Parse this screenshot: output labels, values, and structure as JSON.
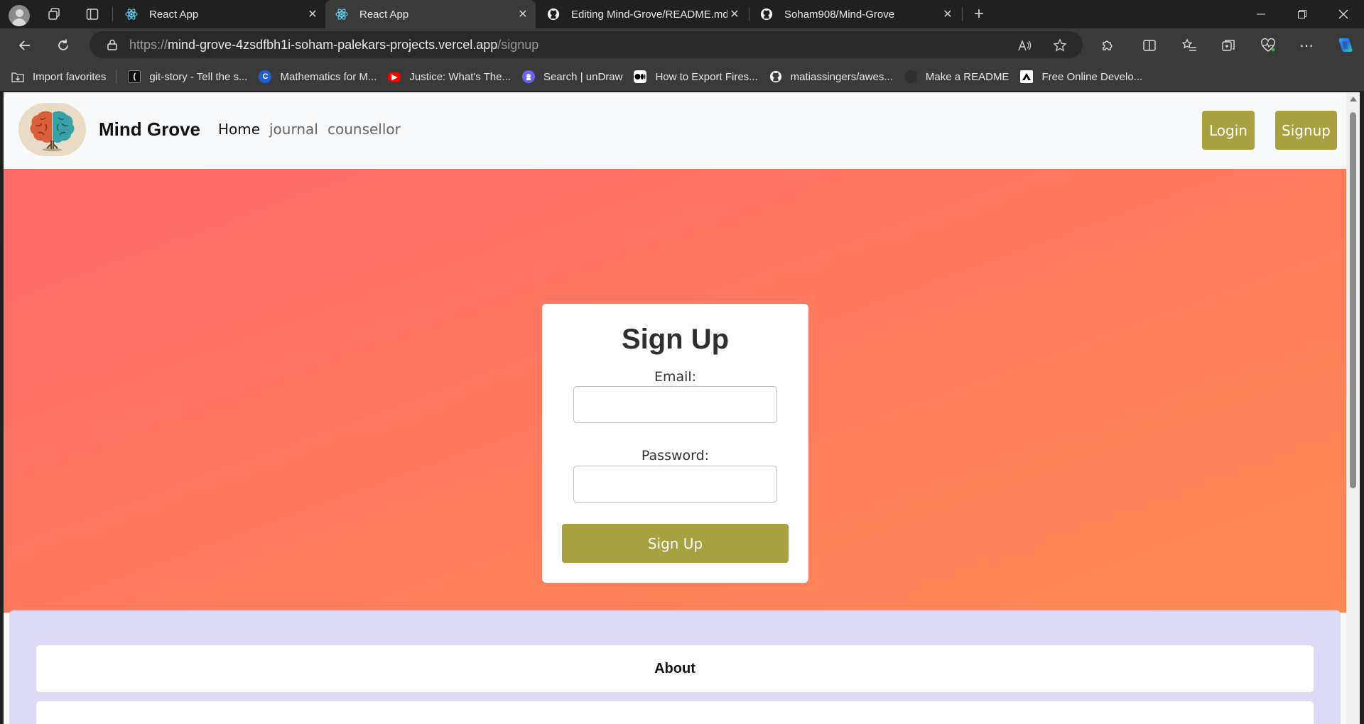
{
  "browser": {
    "tabs": [
      {
        "title": "React App",
        "favicon": "react-icon",
        "active": false
      },
      {
        "title": "React App",
        "favicon": "react-icon",
        "active": true
      },
      {
        "title": "Editing Mind-Grove/README.md",
        "favicon": "github-icon",
        "active": false
      },
      {
        "title": "Soham908/Mind-Grove",
        "favicon": "github-icon",
        "active": false
      }
    ],
    "url_scheme": "https://",
    "url_host": "mind-grove-4zsdfbh1i-soham-palekars-projects.vercel.app",
    "url_path": "/signup",
    "bookmarks": [
      {
        "label": "Import favorites",
        "icon": "import-icon"
      },
      {
        "label": "git-story - Tell the s...",
        "icon": "git-story-icon"
      },
      {
        "label": "Mathematics for M...",
        "icon": "coursera-icon"
      },
      {
        "label": "Justice: What's The...",
        "icon": "youtube-icon"
      },
      {
        "label": "Search | unDraw",
        "icon": "undraw-icon"
      },
      {
        "label": "How to Export Fires...",
        "icon": "medium-icon"
      },
      {
        "label": "matiassingers/awes...",
        "icon": "github-icon"
      },
      {
        "label": "Make a README",
        "icon": "readme-icon"
      },
      {
        "label": "Free Online Develo...",
        "icon": "dev-tools-icon"
      }
    ],
    "colors": {
      "chrome_dark": "#202020",
      "chrome_mid": "#3a3a3a"
    }
  },
  "site": {
    "brand": "Mind Grove",
    "nav": {
      "home": "Home",
      "journal": "journal",
      "counsellor": "counsellor"
    },
    "login_label": "Login",
    "signup_label": "Signup"
  },
  "signup_form": {
    "title": "Sign Up",
    "email_label": "Email:",
    "email_value": "",
    "password_label": "Password:",
    "password_value": "",
    "submit_label": "Sign Up"
  },
  "sections": {
    "about": "About"
  },
  "colors": {
    "accent": "#a9a040",
    "hero_gradient_start": "#ff6b6b",
    "hero_gradient_end": "#ff8a55",
    "lower_bg": "#dcdaf7"
  }
}
